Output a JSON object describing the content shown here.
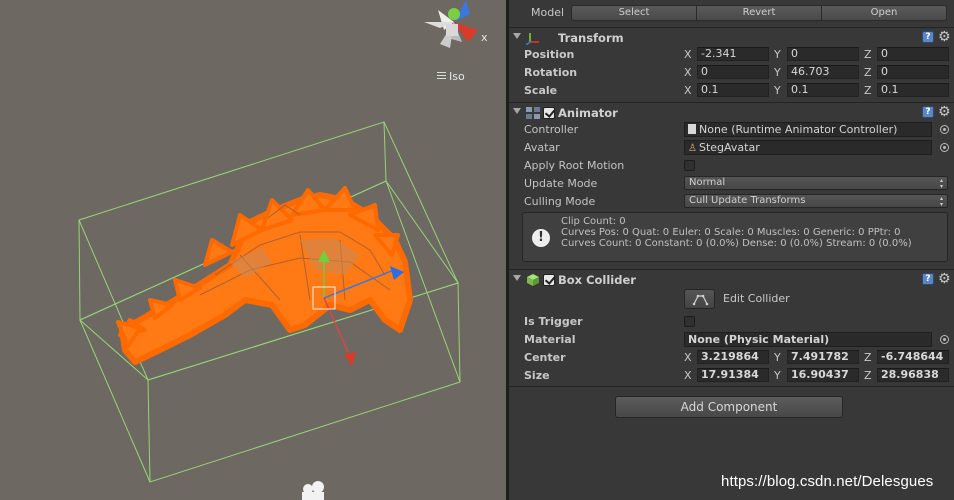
{
  "scene": {
    "projection_label": "Iso",
    "gizmo_axis_label": "x"
  },
  "model_row": {
    "label": "Model",
    "buttons": [
      "Select",
      "Revert",
      "Open"
    ]
  },
  "transform": {
    "title": "Transform",
    "position": {
      "label": "Position",
      "x": "-2.341",
      "y": "0",
      "z": "0"
    },
    "rotation": {
      "label": "Rotation",
      "x": "0",
      "y": "46.703",
      "z": "0"
    },
    "scale": {
      "label": "Scale",
      "x": "0.1",
      "y": "0.1",
      "z": "0.1"
    }
  },
  "animator": {
    "title": "Animator",
    "enabled": true,
    "controller": {
      "label": "Controller",
      "value": "None (Runtime Animator Controller)"
    },
    "avatar": {
      "label": "Avatar",
      "value": "StegAvatar"
    },
    "apply_root_motion": {
      "label": "Apply Root Motion",
      "checked": false
    },
    "update_mode": {
      "label": "Update Mode",
      "value": "Normal"
    },
    "culling_mode": {
      "label": "Culling Mode",
      "value": "Cull Update Transforms"
    },
    "info": {
      "line1": "Clip Count: 0",
      "line2": "Curves Pos: 0 Quat: 0 Euler: 0 Scale: 0 Muscles: 0 Generic: 0 PPtr: 0",
      "line3": "Curves Count: 0 Constant: 0 (0.0%) Dense: 0 (0.0%) Stream: 0 (0.0%)"
    }
  },
  "box_collider": {
    "title": "Box Collider",
    "enabled": true,
    "edit_collider_label": "Edit Collider",
    "is_trigger": {
      "label": "Is Trigger",
      "checked": false
    },
    "material": {
      "label": "Material",
      "value": "None (Physic Material)"
    },
    "center": {
      "label": "Center",
      "x": "3.219864",
      "y": "7.491782",
      "z": "-6.748644"
    },
    "size": {
      "label": "Size",
      "x": "17.91384",
      "y": "16.90437",
      "z": "28.96838"
    }
  },
  "add_component_label": "Add Component",
  "axis_labels": {
    "x": "X",
    "y": "Y",
    "z": "Z"
  },
  "watermark": "https://blog.csdn.net/Delesgues",
  "colors": {
    "scene_bg": "#6e6862",
    "inspector_bg": "#383838",
    "bounds_line": "#9be07a",
    "mesh_orange": "#ff7a14",
    "help_blue": "#5b86c0"
  }
}
